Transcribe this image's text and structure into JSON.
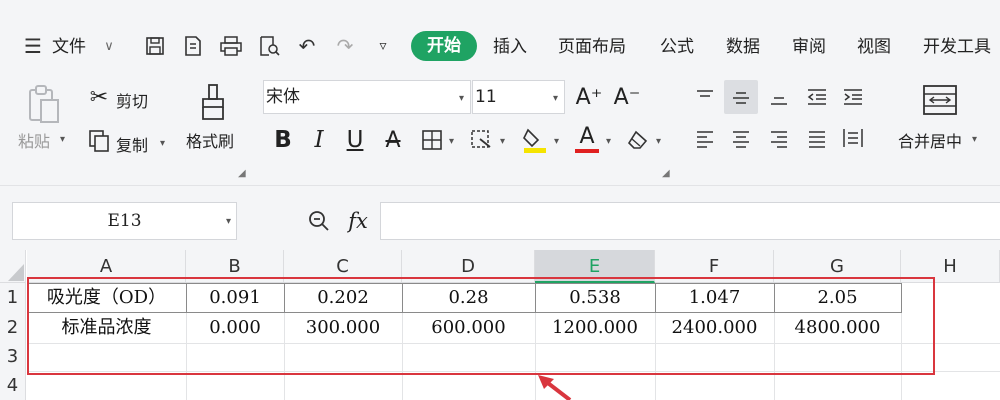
{
  "menu": {
    "file_label": "文件",
    "tabs": [
      {
        "label": "开始",
        "active": true
      },
      {
        "label": "插入"
      },
      {
        "label": "页面布局"
      },
      {
        "label": "公式"
      },
      {
        "label": "数据"
      },
      {
        "label": "审阅"
      },
      {
        "label": "视图"
      },
      {
        "label": "开发工具"
      }
    ]
  },
  "ribbon": {
    "paste_label": "粘贴",
    "cut_label": "剪切",
    "copy_label": "复制",
    "format_painter_label": "格式刷",
    "font_name": "宋体",
    "font_size": "11",
    "increase_font_glyph": "A⁺",
    "decrease_font_glyph": "A⁻",
    "bold_glyph": "B",
    "italic_glyph": "I",
    "underline_glyph": "U",
    "strike_glyph": "A",
    "font_color_glyph": "A",
    "merge_center_label": "合并居中",
    "fill_color": "#f5e400",
    "font_color": "#e02020"
  },
  "formula_bar": {
    "name_box": "E13",
    "fx_label": "fx",
    "formula": ""
  },
  "sheet": {
    "columns": [
      "A",
      "B",
      "C",
      "D",
      "E",
      "F",
      "G",
      "H"
    ],
    "selected_column": "E",
    "rows": [
      "1",
      "2",
      "3",
      "4"
    ],
    "cells": [
      [
        "吸光度（OD）",
        "0.091",
        "0.202",
        "0.28",
        "0.538",
        "1.047",
        "2.05"
      ],
      [
        "标准品浓度",
        "0.000",
        "300.000",
        "600.000",
        "1200.000",
        "2400.000",
        "4800.000"
      ]
    ]
  },
  "colors": {
    "accent_green": "#1fa363",
    "annotation_red": "#d9363e"
  }
}
